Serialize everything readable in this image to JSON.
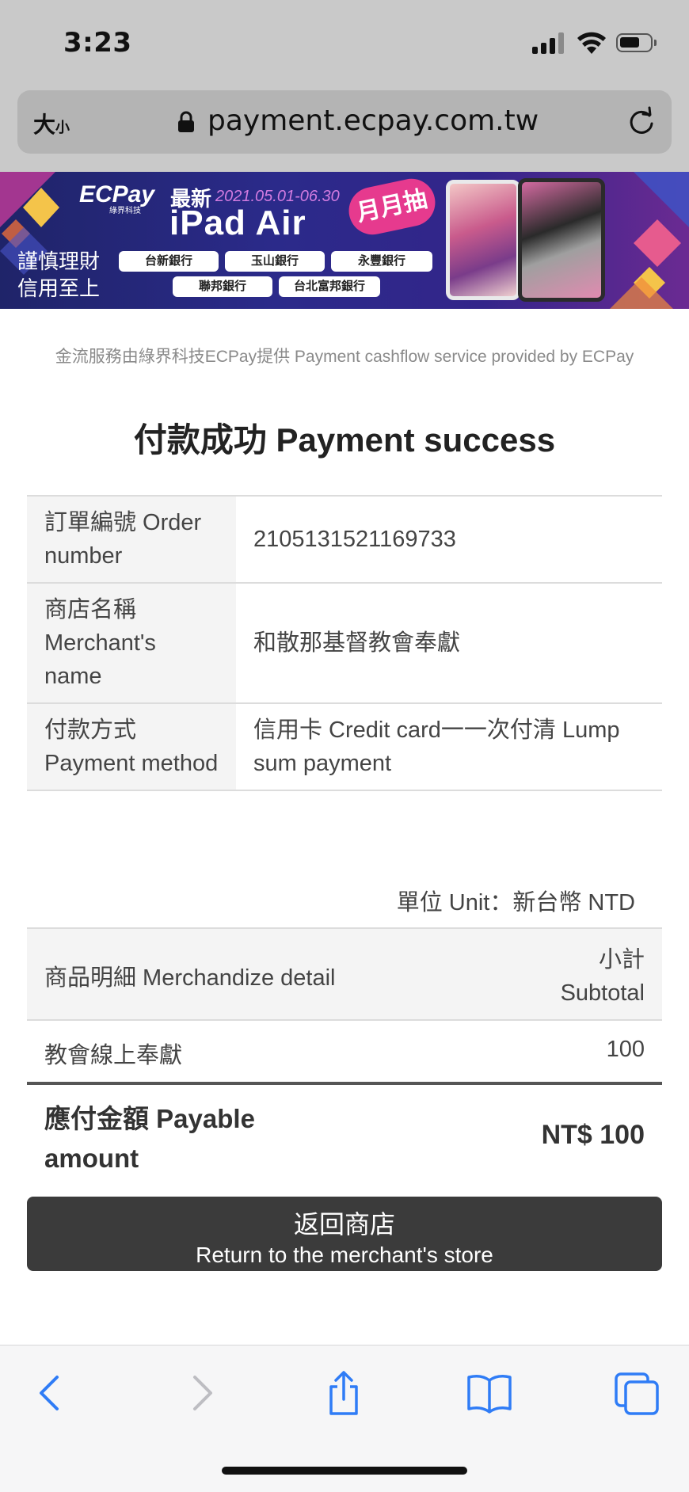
{
  "status_bar": {
    "time": "3:23"
  },
  "browser": {
    "text_size_label": "大",
    "text_size_small": "小",
    "url": "payment.ecpay.com.tw"
  },
  "banner": {
    "brand": "ECPay",
    "brand_sub": "綠界科技",
    "new_label": "最新",
    "dates": "2021.05.01-06.30",
    "product": "iPad Air",
    "badge": "月月抽",
    "slogan_line1": "謹慎理財",
    "slogan_line2": "信用至上",
    "banks": [
      "台新銀行",
      "玉山銀行",
      "永豐銀行",
      "聯邦銀行",
      "台北富邦銀行"
    ]
  },
  "page": {
    "provider_note": "金流服務由綠界科技ECPay提供 Payment cashflow service provided by ECPay",
    "title": "付款成功 Payment success",
    "info_rows": [
      {
        "label": "訂單編號 Order number",
        "value": "2105131521169733"
      },
      {
        "label": "商店名稱 Merchant's name",
        "value": "和散那基督教會奉獻"
      },
      {
        "label": "付款方式 Payment method",
        "value": "信用卡 Credit card一一次付清 Lump sum payment"
      }
    ],
    "unit_note": "單位 Unit：新台幣 NTD",
    "merch_header": {
      "detail": "商品明細 Merchandize detail",
      "subtotal_zh": "小計",
      "subtotal_en": "Subtotal"
    },
    "merch_item": {
      "name": "教會線上奉獻",
      "amount": "100"
    },
    "payable_label_1": "應付金額 Payable",
    "payable_label_2": "amount",
    "payable_value": "NT$ 100",
    "return_button_zh": "返回商店",
    "return_button_en": "Return to the merchant's store"
  },
  "toolbar_icons": [
    "back-icon",
    "forward-icon",
    "share-icon",
    "bookmarks-icon",
    "tabs-icon"
  ],
  "colors": {
    "accent": "#2f7cf6",
    "button_bg": "#3b3b3b",
    "banner_bg": "#2b2a8a"
  }
}
